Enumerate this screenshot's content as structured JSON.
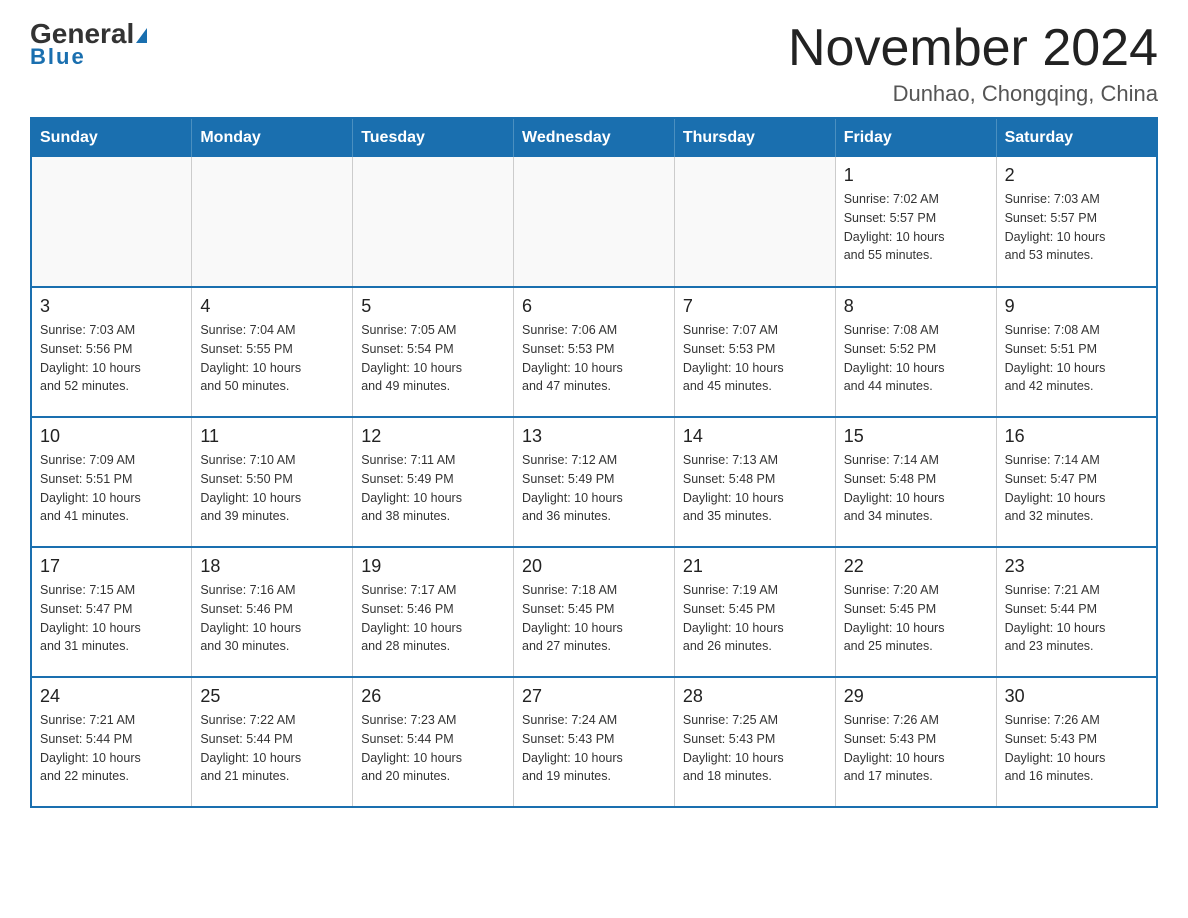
{
  "header": {
    "logo_general": "General",
    "logo_blue": "Blue",
    "month_title": "November 2024",
    "location": "Dunhao, Chongqing, China"
  },
  "days_of_week": [
    "Sunday",
    "Monday",
    "Tuesday",
    "Wednesday",
    "Thursday",
    "Friday",
    "Saturday"
  ],
  "weeks": [
    [
      {
        "day": "",
        "info": ""
      },
      {
        "day": "",
        "info": ""
      },
      {
        "day": "",
        "info": ""
      },
      {
        "day": "",
        "info": ""
      },
      {
        "day": "",
        "info": ""
      },
      {
        "day": "1",
        "info": "Sunrise: 7:02 AM\nSunset: 5:57 PM\nDaylight: 10 hours\nand 55 minutes."
      },
      {
        "day": "2",
        "info": "Sunrise: 7:03 AM\nSunset: 5:57 PM\nDaylight: 10 hours\nand 53 minutes."
      }
    ],
    [
      {
        "day": "3",
        "info": "Sunrise: 7:03 AM\nSunset: 5:56 PM\nDaylight: 10 hours\nand 52 minutes."
      },
      {
        "day": "4",
        "info": "Sunrise: 7:04 AM\nSunset: 5:55 PM\nDaylight: 10 hours\nand 50 minutes."
      },
      {
        "day": "5",
        "info": "Sunrise: 7:05 AM\nSunset: 5:54 PM\nDaylight: 10 hours\nand 49 minutes."
      },
      {
        "day": "6",
        "info": "Sunrise: 7:06 AM\nSunset: 5:53 PM\nDaylight: 10 hours\nand 47 minutes."
      },
      {
        "day": "7",
        "info": "Sunrise: 7:07 AM\nSunset: 5:53 PM\nDaylight: 10 hours\nand 45 minutes."
      },
      {
        "day": "8",
        "info": "Sunrise: 7:08 AM\nSunset: 5:52 PM\nDaylight: 10 hours\nand 44 minutes."
      },
      {
        "day": "9",
        "info": "Sunrise: 7:08 AM\nSunset: 5:51 PM\nDaylight: 10 hours\nand 42 minutes."
      }
    ],
    [
      {
        "day": "10",
        "info": "Sunrise: 7:09 AM\nSunset: 5:51 PM\nDaylight: 10 hours\nand 41 minutes."
      },
      {
        "day": "11",
        "info": "Sunrise: 7:10 AM\nSunset: 5:50 PM\nDaylight: 10 hours\nand 39 minutes."
      },
      {
        "day": "12",
        "info": "Sunrise: 7:11 AM\nSunset: 5:49 PM\nDaylight: 10 hours\nand 38 minutes."
      },
      {
        "day": "13",
        "info": "Sunrise: 7:12 AM\nSunset: 5:49 PM\nDaylight: 10 hours\nand 36 minutes."
      },
      {
        "day": "14",
        "info": "Sunrise: 7:13 AM\nSunset: 5:48 PM\nDaylight: 10 hours\nand 35 minutes."
      },
      {
        "day": "15",
        "info": "Sunrise: 7:14 AM\nSunset: 5:48 PM\nDaylight: 10 hours\nand 34 minutes."
      },
      {
        "day": "16",
        "info": "Sunrise: 7:14 AM\nSunset: 5:47 PM\nDaylight: 10 hours\nand 32 minutes."
      }
    ],
    [
      {
        "day": "17",
        "info": "Sunrise: 7:15 AM\nSunset: 5:47 PM\nDaylight: 10 hours\nand 31 minutes."
      },
      {
        "day": "18",
        "info": "Sunrise: 7:16 AM\nSunset: 5:46 PM\nDaylight: 10 hours\nand 30 minutes."
      },
      {
        "day": "19",
        "info": "Sunrise: 7:17 AM\nSunset: 5:46 PM\nDaylight: 10 hours\nand 28 minutes."
      },
      {
        "day": "20",
        "info": "Sunrise: 7:18 AM\nSunset: 5:45 PM\nDaylight: 10 hours\nand 27 minutes."
      },
      {
        "day": "21",
        "info": "Sunrise: 7:19 AM\nSunset: 5:45 PM\nDaylight: 10 hours\nand 26 minutes."
      },
      {
        "day": "22",
        "info": "Sunrise: 7:20 AM\nSunset: 5:45 PM\nDaylight: 10 hours\nand 25 minutes."
      },
      {
        "day": "23",
        "info": "Sunrise: 7:21 AM\nSunset: 5:44 PM\nDaylight: 10 hours\nand 23 minutes."
      }
    ],
    [
      {
        "day": "24",
        "info": "Sunrise: 7:21 AM\nSunset: 5:44 PM\nDaylight: 10 hours\nand 22 minutes."
      },
      {
        "day": "25",
        "info": "Sunrise: 7:22 AM\nSunset: 5:44 PM\nDaylight: 10 hours\nand 21 minutes."
      },
      {
        "day": "26",
        "info": "Sunrise: 7:23 AM\nSunset: 5:44 PM\nDaylight: 10 hours\nand 20 minutes."
      },
      {
        "day": "27",
        "info": "Sunrise: 7:24 AM\nSunset: 5:43 PM\nDaylight: 10 hours\nand 19 minutes."
      },
      {
        "day": "28",
        "info": "Sunrise: 7:25 AM\nSunset: 5:43 PM\nDaylight: 10 hours\nand 18 minutes."
      },
      {
        "day": "29",
        "info": "Sunrise: 7:26 AM\nSunset: 5:43 PM\nDaylight: 10 hours\nand 17 minutes."
      },
      {
        "day": "30",
        "info": "Sunrise: 7:26 AM\nSunset: 5:43 PM\nDaylight: 10 hours\nand 16 minutes."
      }
    ]
  ]
}
